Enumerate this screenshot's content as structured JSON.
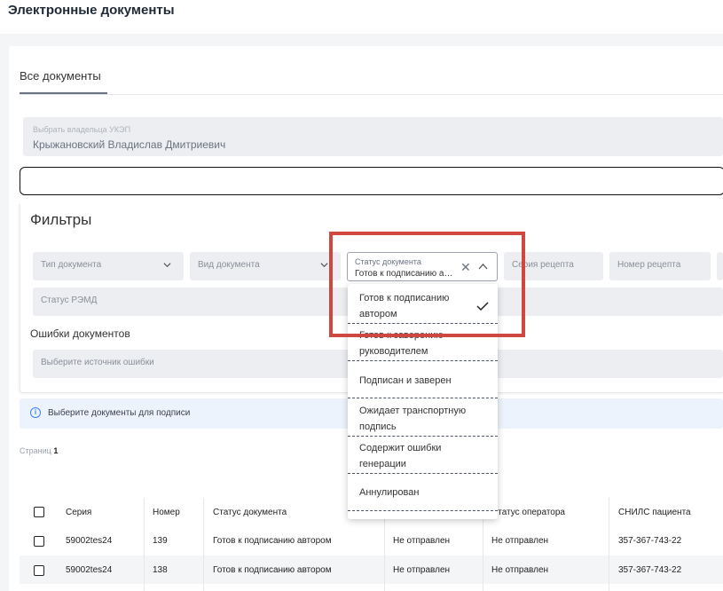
{
  "page_title": "Электронные документы",
  "tabs": [
    "Все документы"
  ],
  "owner": {
    "label": "Выбрать владельца УКЭП",
    "value": "Крыжановский Владислав Дмитриевич"
  },
  "filters": {
    "title": "Фильтры",
    "doc_type": "Тип документа",
    "doc_kind": "Вид документа",
    "status": {
      "label": "Статус документа",
      "value": "Готов к подписанию автором"
    },
    "recipe_series": "Серия рецепта",
    "recipe_number": "Номер рецепта",
    "remd_status": "Статус РЭМД",
    "errors_label": "Ошибки документов",
    "errors_placeholder": "Выберите источник ошибки"
  },
  "info_message": "Выберите документы для подписи",
  "pagination": {
    "label": "Страниц",
    "count": "1"
  },
  "table": {
    "headers": [
      "Серия",
      "Номер",
      "Статус документа",
      "Статус оператора",
      "СНИЛС пациента"
    ],
    "rows": [
      {
        "series": "59002tes24",
        "number": "139",
        "status": "Готов к подписанию автором",
        "transport": "Не отправлен",
        "operator": "Не отправлен",
        "snils": "357-367-743-22"
      },
      {
        "series": "59002tes24",
        "number": "138",
        "status": "Готов к подписанию автором",
        "transport": "Не отправлен",
        "operator": "Не отправлен",
        "snils": "357-367-743-22"
      }
    ]
  },
  "dropdown_options": [
    {
      "line1": "Готов к подписанию",
      "line2": "автором",
      "selected": true
    },
    {
      "line1": "Готов к заверению",
      "line2": "руководителем",
      "selected": false
    },
    {
      "line1": "Подписан и заверен",
      "line2": "",
      "selected": false
    },
    {
      "line1": "Ожидает транспортную",
      "line2": "подпись",
      "selected": false
    },
    {
      "line1": "Содержит ошибки",
      "line2": "генерации",
      "selected": false
    },
    {
      "line1": "Аннулирован",
      "line2": "",
      "selected": false
    }
  ],
  "colors": {
    "highlight": "#d0473f",
    "info_bg": "#edf3fc",
    "field_bg": "#eceef1"
  }
}
